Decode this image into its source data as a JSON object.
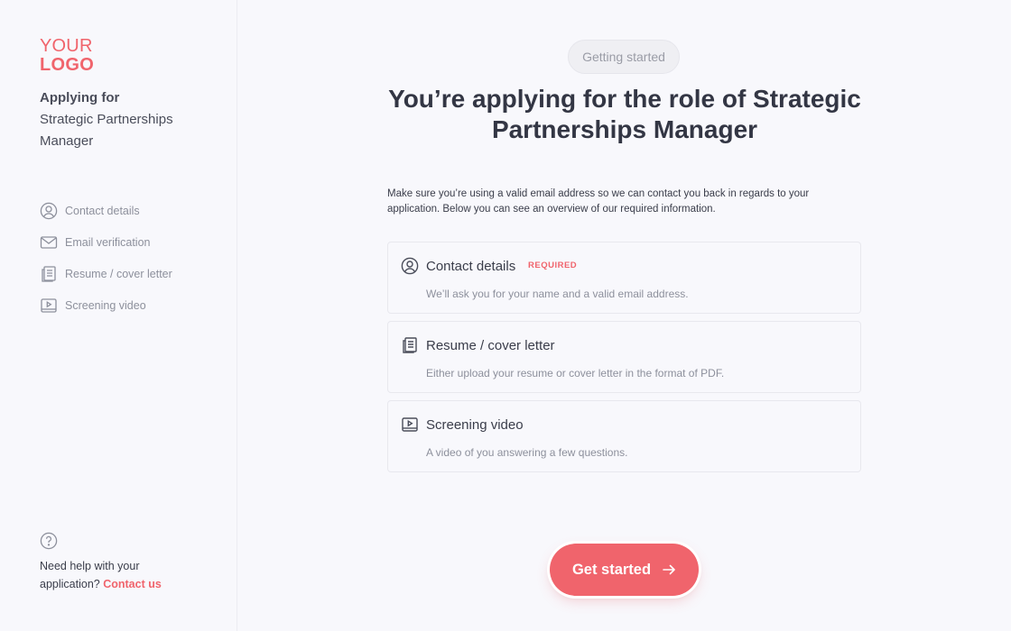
{
  "logo": {
    "line1": "YOUR",
    "line2": "LOGO"
  },
  "sidebar": {
    "applying_title": "Applying for",
    "role": "Strategic Partnerships Manager",
    "steps": [
      {
        "label": "Contact details",
        "icon": "user-circle-icon"
      },
      {
        "label": "Email verification",
        "icon": "envelope-icon"
      },
      {
        "label": "Resume / cover letter",
        "icon": "document-icon"
      },
      {
        "label": "Screening video",
        "icon": "video-icon"
      }
    ],
    "help": {
      "icon": "question-circle-icon",
      "text_line1": "Need help with your",
      "text_line2": "application?",
      "link": "Contact us"
    }
  },
  "main": {
    "badge": "Getting started",
    "headline": "You’re applying for the role of Strategic Partnerships Manager",
    "intro": "Make sure you’re using a valid email address so we can contact you back in regards to your application. Below you can see an overview of our required information.",
    "cards": [
      {
        "title": "Contact details",
        "required": "REQUIRED",
        "description": "We’ll ask you for your name and a valid email address.",
        "icon": "user-circle-icon"
      },
      {
        "title": "Resume / cover letter",
        "description": "Either upload your resume or cover letter in the format of PDF.",
        "icon": "document-icon"
      },
      {
        "title": "Screening video",
        "description": "A video of you answering a few questions.",
        "icon": "video-icon"
      }
    ],
    "cta": {
      "label": "Get started",
      "icon": "arrow-right-icon"
    }
  },
  "colors": {
    "accent": "#f0646c",
    "background": "#f8f8fc",
    "text": "#3a3d4a",
    "muted": "#8d909c"
  }
}
